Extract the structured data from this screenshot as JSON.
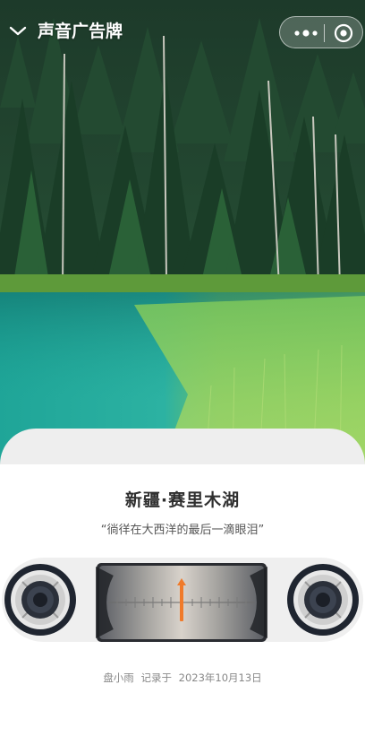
{
  "navbar": {
    "title": "声音广告牌",
    "back_icon": "chevron-down-icon",
    "more_icon": "more-dots-icon",
    "close_icon": "target-circle-icon"
  },
  "hero": {
    "subject": "forest lake photo"
  },
  "card": {
    "place_name": "新疆·赛里木湖",
    "quote": "“徜徉在大西洋的最后一滴眼泪”"
  },
  "player": {
    "left_icon": "speaker-icon",
    "right_icon": "speaker-icon",
    "tuner_icon": "radio-tuner-icon",
    "accent_color": "#f07a2a"
  },
  "footer": {
    "author": "盘小雨",
    "recorded_label": "记录于",
    "date": "2023年10月13日"
  }
}
